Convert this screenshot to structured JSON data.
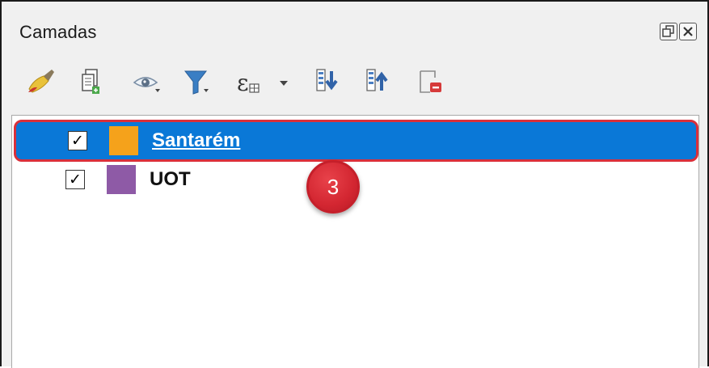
{
  "panel": {
    "title": "Camadas"
  },
  "toolbar": {
    "tools": [
      {
        "name": "style-brush",
        "icon": "paintbrush-icon"
      },
      {
        "name": "add-group",
        "icon": "add-group-icon"
      },
      {
        "name": "visibility",
        "icon": "eye-icon"
      },
      {
        "name": "filter",
        "icon": "funnel-icon"
      },
      {
        "name": "expression-filter",
        "icon": "epsilon-icon"
      },
      {
        "name": "expand-all",
        "icon": "expand-all-icon"
      },
      {
        "name": "collapse-all",
        "icon": "collapse-all-icon"
      },
      {
        "name": "remove-layer",
        "icon": "remove-layer-icon"
      }
    ]
  },
  "layers": [
    {
      "name": "Santarém",
      "checked": "✓",
      "color": "#f5a21b",
      "selected": true
    },
    {
      "name": "UOT",
      "checked": "✓",
      "color": "#8e5aa6",
      "selected": false
    }
  ],
  "annotation": {
    "badge_number": "3",
    "badge_color": "#d32631",
    "highlight_color": "#d9303b"
  },
  "colors": {
    "selection": "#0a78d7",
    "panel_bg": "#f0f0f0"
  }
}
